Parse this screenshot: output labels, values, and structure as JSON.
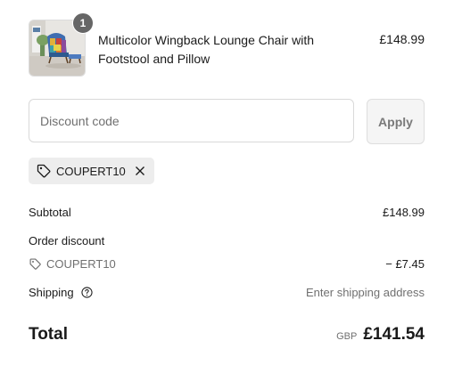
{
  "product": {
    "quantity": "1",
    "name": "Multicolor Wingback Lounge Chair with Footstool and Pillow",
    "price": "£148.99",
    "image_icon": "chair-thumbnail-image"
  },
  "discount": {
    "placeholder": "Discount code",
    "value": "",
    "apply_label": "Apply",
    "applied_code": "COUPERT10"
  },
  "summary": {
    "subtotal_label": "Subtotal",
    "subtotal_value": "£148.99",
    "order_discount_label": "Order discount",
    "discount_code": "COUPERT10",
    "discount_value": "− £7.45",
    "shipping_label": "Shipping",
    "shipping_value": "Enter shipping address",
    "total_label": "Total",
    "currency": "GBP",
    "total_value": "£141.54"
  },
  "colors": {
    "badge": "#666666",
    "chip_bg": "#ededed",
    "muted_text": "#707070"
  }
}
